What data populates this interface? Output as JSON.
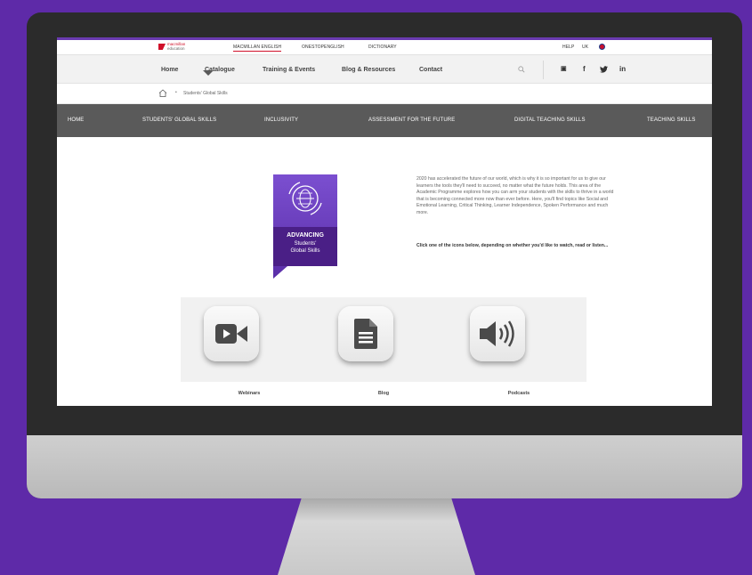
{
  "utility_bar": {
    "logo_top": "macmillan",
    "logo_bottom": "education",
    "links": [
      "MACMILLAN ENGLISH",
      "ONESTOPENGLISH",
      "DICTIONARY"
    ],
    "help": "HELP",
    "region": "UK"
  },
  "main_nav": {
    "items": [
      "Home",
      "Catalogue",
      "Training & Events",
      "Blog & Resources",
      "Contact"
    ],
    "social": [
      "youtube-icon",
      "facebook-icon",
      "twitter-icon",
      "linkedin-icon"
    ],
    "social_glyphs": [
      "▣",
      "f",
      "🐦",
      "in"
    ]
  },
  "breadcrumb": {
    "separator": "•",
    "current": "Students' Global Skills"
  },
  "section_nav": {
    "items": [
      "HOME",
      "STUDENTS' GLOBAL SKILLS",
      "INCLUSIVITY",
      "ASSESSMENT FOR THE FUTURE",
      "DIGITAL TEACHING SKILLS",
      "TEACHING SKILLS"
    ],
    "active_index": 1
  },
  "badge": {
    "line1": "ADVANCING",
    "line2": "Students'",
    "line3": "Global Skills",
    "color_top": "#7b4fd0",
    "color_bottom": "#4a1f86"
  },
  "content": {
    "intro": "2020 has accelerated the future of our world, which is why it is so important for us to give our learners the tools they'll need to succeed, no matter what the future holds. This area of the Academic Programme explores how you can arm your students with the skills to thrive in a world that is becoming connected more now than ever before. Here, you'll find topics like Social and Emotional Learning, Critical Thinking, Learner Independence, Spoken Performance and much more.",
    "cta": "Click one of the icons below, depending on whether you'd like to watch, read or listen..."
  },
  "resources": [
    {
      "label": "Webinars",
      "icon": "video-camera-icon"
    },
    {
      "label": "Blog",
      "icon": "document-icon"
    },
    {
      "label": "Podcasts",
      "icon": "speaker-icon"
    }
  ],
  "colors": {
    "background": "#5e2aa8",
    "accent_red": "#d0102a",
    "section_nav": "#5a5a5a",
    "icon_dark": "#4a4a4a"
  }
}
